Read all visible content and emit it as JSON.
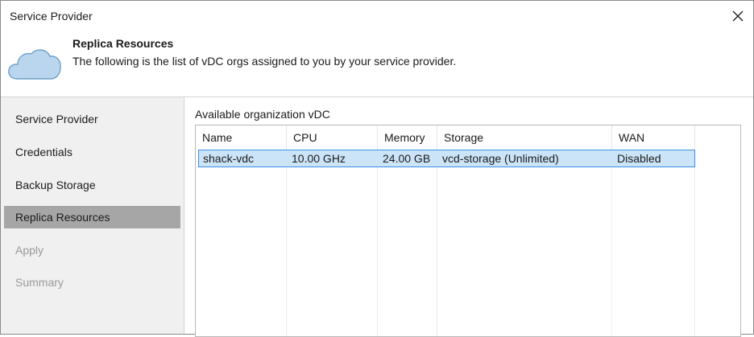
{
  "window": {
    "title": "Service Provider"
  },
  "header": {
    "title": "Replica Resources",
    "description": "The following is the list of vDC orgs assigned to you by your service provider."
  },
  "sidebar": {
    "items": [
      {
        "label": "Service Provider",
        "state": "normal"
      },
      {
        "label": "Credentials",
        "state": "normal"
      },
      {
        "label": "Backup Storage",
        "state": "normal"
      },
      {
        "label": "Replica Resources",
        "state": "active"
      },
      {
        "label": "Apply",
        "state": "disabled"
      },
      {
        "label": "Summary",
        "state": "disabled"
      }
    ]
  },
  "main": {
    "group_label": "Available organization vDC",
    "table": {
      "columns": [
        "Name",
        "CPU",
        "Memory",
        "Storage",
        "WAN"
      ],
      "rows": [
        {
          "cells": [
            "shack-vdc",
            "10.00 GHz",
            "24.00 GB",
            "vcd-storage (Unlimited)",
            "Disabled"
          ],
          "selected": true
        }
      ]
    }
  },
  "colors": {
    "selection_fill": "#cce4f7",
    "selection_border": "#3d8ee6",
    "sidebar_bg": "#f0f0f0",
    "sidebar_active": "#a6a6a6",
    "cloud_fill": "#b9d6ee"
  },
  "icons": {
    "close": "close-icon",
    "header": "cloud-icon"
  }
}
